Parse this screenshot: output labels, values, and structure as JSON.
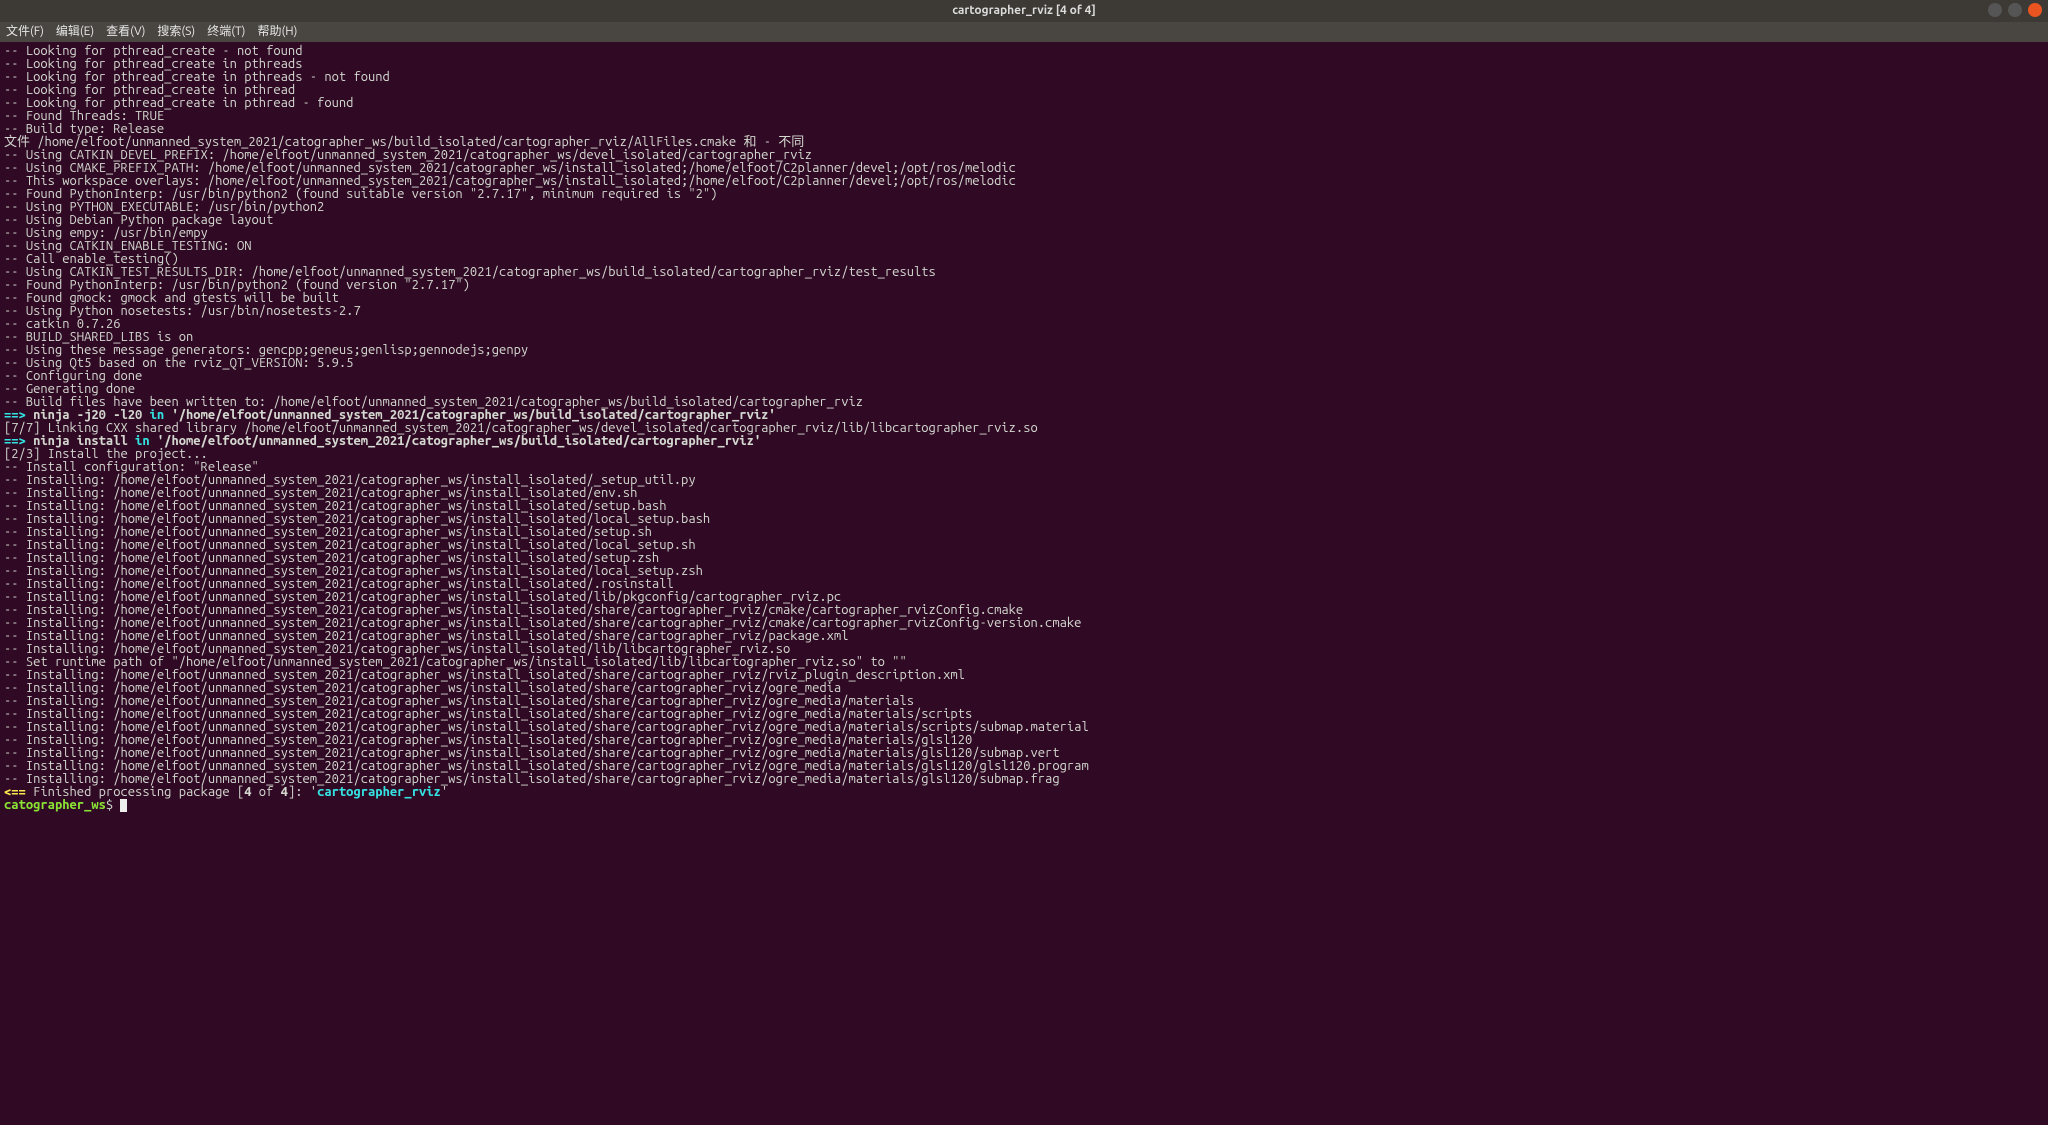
{
  "title": "cartographer_rviz [4 of 4]",
  "menu": {
    "file": "文件(F)",
    "edit": "编辑(E)",
    "view": "查看(V)",
    "search": "搜索(S)",
    "terminal": "终端(T)",
    "help": "帮助(H)"
  },
  "lines_top": [
    "-- Looking for pthread_create - not found",
    "-- Looking for pthread_create in pthreads",
    "-- Looking for pthread_create in pthreads - not found",
    "-- Looking for pthread_create in pthread",
    "-- Looking for pthread_create in pthread - found",
    "-- Found Threads: TRUE",
    "-- Build type: Release",
    "文件 /home/elfoot/unmanned_system_2021/catographer_ws/build_isolated/cartographer_rviz/AllFiles.cmake 和 - 不同",
    "-- Using CATKIN_DEVEL_PREFIX: /home/elfoot/unmanned_system_2021/catographer_ws/devel_isolated/cartographer_rviz",
    "-- Using CMAKE_PREFIX_PATH: /home/elfoot/unmanned_system_2021/catographer_ws/install_isolated;/home/elfoot/C2planner/devel;/opt/ros/melodic",
    "-- This workspace overlays: /home/elfoot/unmanned_system_2021/catographer_ws/install_isolated;/home/elfoot/C2planner/devel;/opt/ros/melodic",
    "-- Found PythonInterp: /usr/bin/python2 (found suitable version \"2.7.17\", minimum required is \"2\")",
    "-- Using PYTHON_EXECUTABLE: /usr/bin/python2",
    "-- Using Debian Python package layout",
    "-- Using empy: /usr/bin/empy",
    "-- Using CATKIN_ENABLE_TESTING: ON",
    "-- Call enable_testing()",
    "-- Using CATKIN_TEST_RESULTS_DIR: /home/elfoot/unmanned_system_2021/catographer_ws/build_isolated/cartographer_rviz/test_results",
    "-- Found PythonInterp: /usr/bin/python2 (found version \"2.7.17\")",
    "-- Found gmock: gmock and gtests will be built",
    "-- Using Python nosetests: /usr/bin/nosetests-2.7",
    "-- catkin 0.7.26",
    "-- BUILD_SHARED_LIBS is on",
    "-- Using these message generators: gencpp;geneus;genlisp;gennodejs;genpy",
    "-- Using Qt5 based on the rviz_QT_VERSION: 5.9.5",
    "-- Configuring done",
    "-- Generating done",
    "-- Build files have been written to: /home/elfoot/unmanned_system_2021/catographer_ws/build_isolated/cartographer_rviz"
  ],
  "ninja1": {
    "arrow": "==> ",
    "cmd": "ninja -j20 -l20",
    "in": " in ",
    "path": "'/home/elfoot/unmanned_system_2021/catographer_ws/build_isolated/cartographer_rviz'"
  },
  "linkline": "[7/7] Linking CXX shared library /home/elfoot/unmanned_system_2021/catographer_ws/devel_isolated/cartographer_rviz/lib/libcartographer_rviz.so",
  "ninja2": {
    "arrow": "==> ",
    "cmd": "ninja install",
    "in": " in ",
    "path": "'/home/elfoot/unmanned_system_2021/catographer_ws/build_isolated/cartographer_rviz'"
  },
  "installhdr": "[2/3] Install the project...",
  "lines_install": [
    "-- Install configuration: \"Release\"",
    "-- Installing: /home/elfoot/unmanned_system_2021/catographer_ws/install_isolated/_setup_util.py",
    "-- Installing: /home/elfoot/unmanned_system_2021/catographer_ws/install_isolated/env.sh",
    "-- Installing: /home/elfoot/unmanned_system_2021/catographer_ws/install_isolated/setup.bash",
    "-- Installing: /home/elfoot/unmanned_system_2021/catographer_ws/install_isolated/local_setup.bash",
    "-- Installing: /home/elfoot/unmanned_system_2021/catographer_ws/install_isolated/setup.sh",
    "-- Installing: /home/elfoot/unmanned_system_2021/catographer_ws/install_isolated/local_setup.sh",
    "-- Installing: /home/elfoot/unmanned_system_2021/catographer_ws/install_isolated/setup.zsh",
    "-- Installing: /home/elfoot/unmanned_system_2021/catographer_ws/install_isolated/local_setup.zsh",
    "-- Installing: /home/elfoot/unmanned_system_2021/catographer_ws/install_isolated/.rosinstall",
    "-- Installing: /home/elfoot/unmanned_system_2021/catographer_ws/install_isolated/lib/pkgconfig/cartographer_rviz.pc",
    "-- Installing: /home/elfoot/unmanned_system_2021/catographer_ws/install_isolated/share/cartographer_rviz/cmake/cartographer_rvizConfig.cmake",
    "-- Installing: /home/elfoot/unmanned_system_2021/catographer_ws/install_isolated/share/cartographer_rviz/cmake/cartographer_rvizConfig-version.cmake",
    "-- Installing: /home/elfoot/unmanned_system_2021/catographer_ws/install_isolated/share/cartographer_rviz/package.xml",
    "-- Installing: /home/elfoot/unmanned_system_2021/catographer_ws/install_isolated/lib/libcartographer_rviz.so",
    "-- Set runtime path of \"/home/elfoot/unmanned_system_2021/catographer_ws/install_isolated/lib/libcartographer_rviz.so\" to \"\"",
    "-- Installing: /home/elfoot/unmanned_system_2021/catographer_ws/install_isolated/share/cartographer_rviz/rviz_plugin_description.xml",
    "-- Installing: /home/elfoot/unmanned_system_2021/catographer_ws/install_isolated/share/cartographer_rviz/ogre_media",
    "-- Installing: /home/elfoot/unmanned_system_2021/catographer_ws/install_isolated/share/cartographer_rviz/ogre_media/materials",
    "-- Installing: /home/elfoot/unmanned_system_2021/catographer_ws/install_isolated/share/cartographer_rviz/ogre_media/materials/scripts",
    "-- Installing: /home/elfoot/unmanned_system_2021/catographer_ws/install_isolated/share/cartographer_rviz/ogre_media/materials/scripts/submap.material",
    "-- Installing: /home/elfoot/unmanned_system_2021/catographer_ws/install_isolated/share/cartographer_rviz/ogre_media/materials/glsl120",
    "-- Installing: /home/elfoot/unmanned_system_2021/catographer_ws/install_isolated/share/cartographer_rviz/ogre_media/materials/glsl120/submap.vert",
    "-- Installing: /home/elfoot/unmanned_system_2021/catographer_ws/install_isolated/share/cartographer_rviz/ogre_media/materials/glsl120/glsl120.program",
    "-- Installing: /home/elfoot/unmanned_system_2021/catographer_ws/install_isolated/share/cartographer_rviz/ogre_media/materials/glsl120/submap.frag"
  ],
  "finished": {
    "arrow": "<== ",
    "pre": "Finished processing package [",
    "num": "4",
    "mid": " of ",
    "tot": "4",
    "post": "]: '",
    "pkg": "cartographer_rviz",
    "end": "'"
  },
  "prompt": {
    "cwd": "catographer_ws",
    "sep": "$ "
  }
}
